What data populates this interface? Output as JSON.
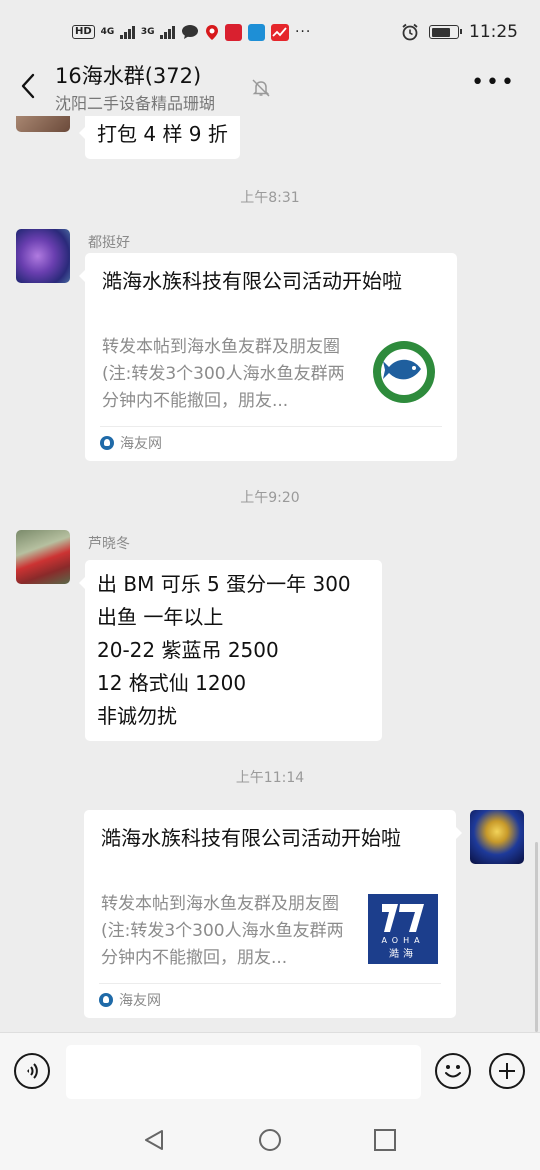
{
  "status_bar": {
    "hd": "HD",
    "net1": "4G",
    "net2": "3G",
    "icons": [
      "message-icon",
      "location-icon",
      "app-red-icon",
      "app-blue-icon",
      "app-chart-icon",
      "more-dots-icon"
    ],
    "more": "···",
    "alarm_icon": "alarm-icon",
    "battery_level": 0.75,
    "time": "11:25"
  },
  "header": {
    "title": "16海水群(372)",
    "subtitle": "沈阳二手设备精品珊瑚",
    "back_icon": "chevron-left-icon",
    "mute_icon": "bell-off-icon",
    "more_icon": "more-horizontal-icon",
    "more_label": "•••"
  },
  "messages": [
    {
      "type": "text",
      "side": "left",
      "text": "打包 4 样 9 折"
    },
    {
      "type": "time",
      "text": "上午8:31"
    },
    {
      "type": "card",
      "side": "left",
      "sender": "都挺好",
      "title": "澔海水族科技有限公司活动开始啦",
      "desc": "转发本帖到海水鱼友群及朋友圈(注:转发3个300人海水鱼友群两分钟内不能撤回，朋友...",
      "source": "海友网"
    },
    {
      "type": "time",
      "text": "上午9:20"
    },
    {
      "type": "text",
      "side": "left",
      "sender": "芦晓冬",
      "lines": [
        "出 BM 可乐 5 蛋分一年  300",
        "出鱼 一年以上",
        "20-22 紫蓝吊 2500",
        "12 格式仙 1200",
        "非诚勿扰"
      ]
    },
    {
      "type": "time",
      "text": "上午11:14"
    },
    {
      "type": "card",
      "side": "right",
      "title": "澔海水族科技有限公司活动开始啦",
      "desc": "转发本帖到海水鱼友群及朋友圈(注:转发3个300人海水鱼友群两分钟内不能撤回，朋友...",
      "source": "海友网",
      "logo_text": "AOHA",
      "logo_cn": "澔海"
    }
  ],
  "input_bar": {
    "voice_icon": "voice-icon",
    "emoji_icon": "emoji-icon",
    "plus_icon": "plus-icon",
    "plus_label": "+"
  },
  "nav_bar": {
    "back_icon": "nav-back-icon",
    "home_icon": "nav-home-icon",
    "recent_icon": "nav-recent-icon"
  },
  "colors": {
    "background": "#ededed",
    "bubble": "#ffffff",
    "muted_text": "#8a8a8a"
  }
}
